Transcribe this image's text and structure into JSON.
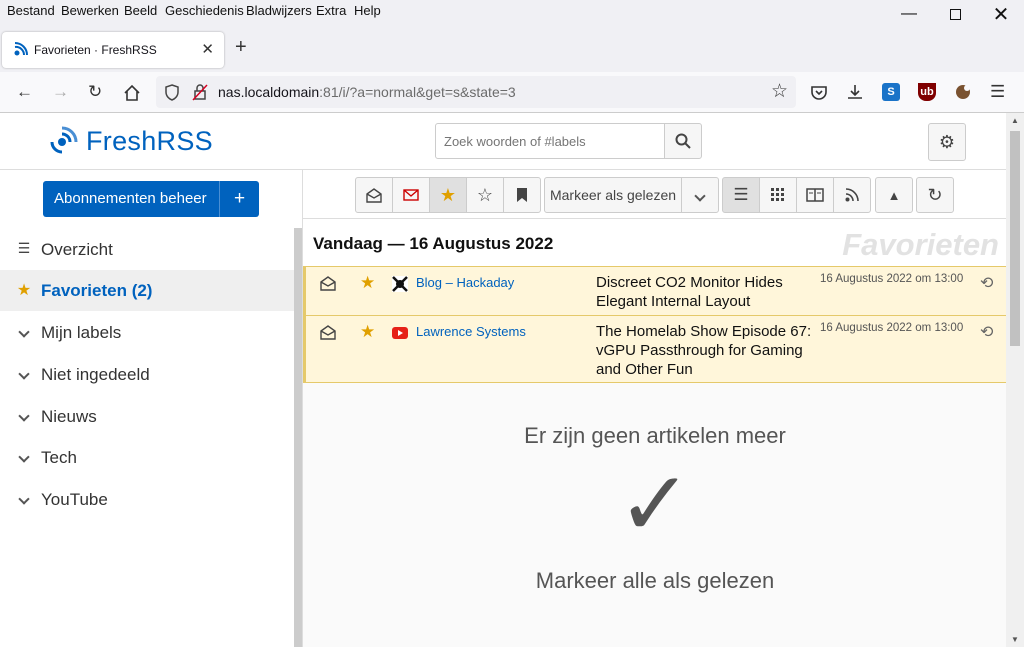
{
  "menubar": {
    "items": [
      "Bestand",
      "Bewerken",
      "Beeld",
      "Geschiedenis",
      "Bladwijzers",
      "Extra",
      "Help"
    ]
  },
  "browser": {
    "tab_title": "Favorieten · FreshRSS",
    "url_host": "nas.localdomain",
    "url_rest": ":81/i/?a=normal&get=s&state=3"
  },
  "header": {
    "logo": "FreshRSS",
    "search_placeholder": "Zoek woorden of #labels"
  },
  "sidebar": {
    "manage_label": "Abonnementen beheer",
    "items": [
      {
        "label": "Overzicht",
        "icon": "list-icon"
      },
      {
        "label": "Favorieten (2)",
        "icon": "star-icon",
        "active": true
      },
      {
        "label": "Mijn labels",
        "icon": "chevron-down-icon"
      },
      {
        "label": "Niet ingedeeld",
        "icon": "chevron-down-icon"
      },
      {
        "label": "Nieuws",
        "icon": "chevron-down-icon"
      },
      {
        "label": "Tech",
        "icon": "chevron-down-icon"
      },
      {
        "label": "YouTube",
        "icon": "chevron-down-icon"
      }
    ]
  },
  "toolbar": {
    "mark_read": "Markeer als gelezen"
  },
  "content": {
    "day": "Vandaag — 16 Augustus 2022",
    "watermark": "Favorieten",
    "articles": [
      {
        "site": "Blog – Hackaday",
        "title": "Discreet CO2 Monitor Hides Elegant Internal Layout",
        "date": "16 Augustus 2022 om 13:00"
      },
      {
        "site": "Lawrence Systems",
        "title": "The Homelab Show Episode 67: vGPU Passthrough for Gaming and Other Fun",
        "date": "16 Augustus 2022 om 13:00"
      }
    ],
    "no_more": "Er zijn geen artikelen meer",
    "check": "✓",
    "mark_all": "Markeer alle als gelezen"
  },
  "colors": {
    "accent": "#0062be",
    "favorite_bg": "#fff6da",
    "star": "#e0a000"
  }
}
